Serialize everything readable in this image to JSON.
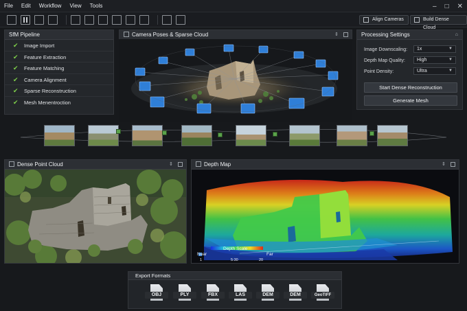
{
  "menubar": {
    "items": [
      "File",
      "Edit",
      "Workflow",
      "View",
      "Tools"
    ],
    "window_controls": [
      "–",
      "□",
      "✕"
    ]
  },
  "toolbar": {
    "align_label": "Align Cameras",
    "build_label": "Build Dense Cloud"
  },
  "sfm": {
    "title": "SfM Pipeline",
    "steps": [
      "Image Import",
      "Feature Extraction",
      "Feature Matching",
      "Camera Alignment",
      "Sparse Reconstruction",
      "Mesh Menentroction"
    ]
  },
  "camera_panel": {
    "title": "Camera Poses & Sparse Cloud"
  },
  "settings": {
    "title": "Processing Settings",
    "rows": [
      {
        "label": "Image Downscaling:",
        "value": "1x"
      },
      {
        "label": "Depth Map Quality:",
        "value": "High"
      },
      {
        "label": "Point Density:",
        "value": "Ultra"
      }
    ],
    "dense_button": "Start Dense Reconstruction",
    "mesh_button": "Generate Mesh"
  },
  "dense": {
    "title": "Dense Point Cloud"
  },
  "depth": {
    "title": "Depth Map",
    "scale_title": "Depth Scale",
    "near": "Near",
    "far": "Far",
    "min_value": "1",
    "mid_value": "5:30",
    "max_value": "20"
  },
  "export": {
    "title": "Export Formats",
    "formats": [
      "OBJ",
      "PLY",
      "FBX",
      "LAS",
      "DEM",
      "DEM",
      "GeoTIFF"
    ]
  },
  "colors": {
    "accent_green": "#7fd14a",
    "camera_blue": "#2f7fd8"
  }
}
